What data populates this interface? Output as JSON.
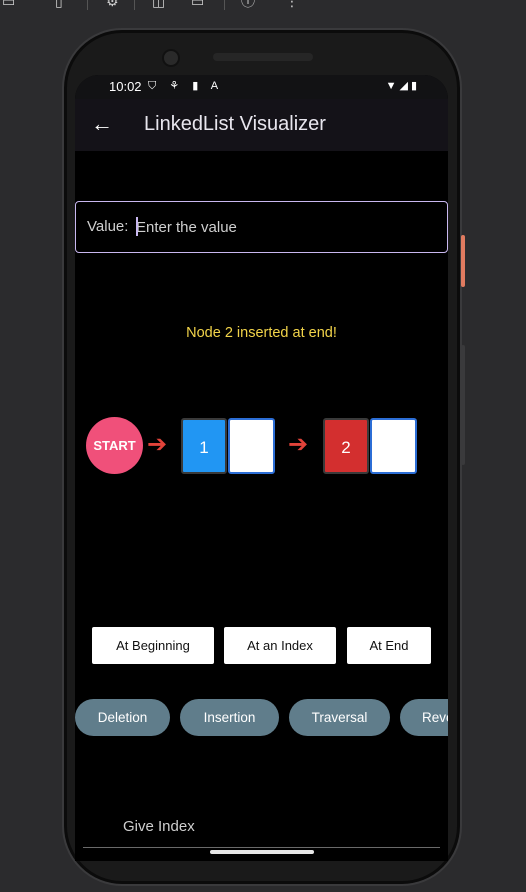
{
  "statusbar": {
    "time": "10:02",
    "left_icons": "⛉ ⚘ ▮ A",
    "right_icons": "▼◢▮"
  },
  "appbar": {
    "title": "LinkedList Visualizer"
  },
  "value_input": {
    "prefix": "Value:",
    "placeholder": "Enter the value",
    "value": ""
  },
  "message": "Node 2 inserted at end!",
  "linked_list": {
    "start_label": "START",
    "nodes": [
      {
        "value": "1",
        "color": "#2196F3"
      },
      {
        "value": "2",
        "color": "#D32F2F"
      }
    ]
  },
  "insert_buttons": {
    "at_beginning": "At Beginning",
    "at_index": "At an Index",
    "at_end": "At End"
  },
  "operation_chips": {
    "deletion": "Deletion",
    "insertion": "Insertion",
    "traversal": "Traversal",
    "reverse": "Reverse"
  },
  "index_field": {
    "label": "Give Index"
  },
  "colors": {
    "start_circle": "#F0507A",
    "message": "#F2D44A",
    "arrow": "#E2433A",
    "chip": "#607D8B",
    "input_border": "#C9B8F0"
  }
}
